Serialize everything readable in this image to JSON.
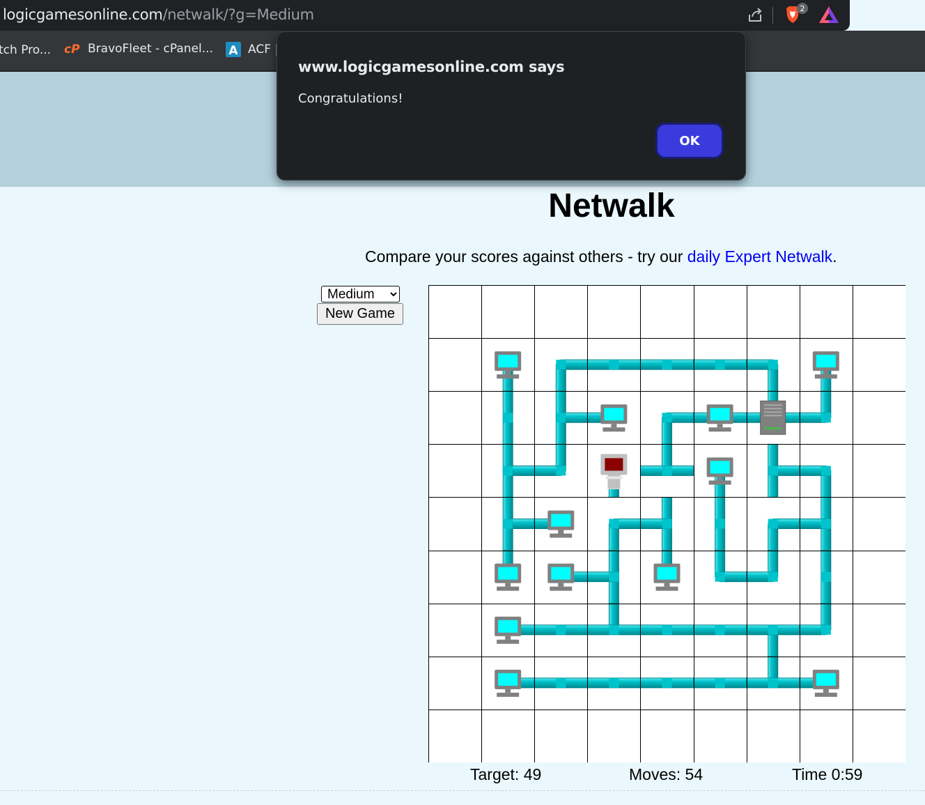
{
  "browser": {
    "url_host": "logicgamesonline.com",
    "url_path": "/netwalk/?g=Medium",
    "brave_badge": "2",
    "bookmarks": [
      {
        "label": "tch Pro...",
        "icon": "none"
      },
      {
        "label": "BravoFleet - cPanel...",
        "icon": "cpanel-icon"
      },
      {
        "label": "ACF |",
        "icon": "acf-icon"
      }
    ]
  },
  "dialog": {
    "title": "www.logicgamesonline.com says",
    "message": "Congratulations!",
    "ok_label": "OK"
  },
  "page": {
    "title": "Netwalk",
    "promo_prefix": "Compare your scores against others - try our ",
    "promo_link": "daily Expert Netwalk",
    "promo_suffix": ".",
    "difficulty_selected": "Medium",
    "new_game_label": "New Game"
  },
  "status": {
    "target": "Target: 49",
    "moves": "Moves: 54",
    "time": "Time 0:59"
  },
  "colors": {
    "pipe": "#00c4cc",
    "grid_line": "#000000",
    "monitor_screen": "#00ffff",
    "server_light": "#8b0000",
    "dialog_button": "#3b3bdd"
  },
  "board": {
    "rows": 9,
    "cols": 9,
    "server": {
      "row": 2,
      "col": 6
    },
    "dead_terminal": {
      "row": 3,
      "col": 3
    },
    "terminals": [
      [
        1,
        1
      ],
      [
        1,
        7
      ],
      [
        2,
        3
      ],
      [
        2,
        5
      ],
      [
        3,
        5
      ],
      [
        4,
        2
      ],
      [
        5,
        1
      ],
      [
        5,
        2
      ],
      [
        5,
        4
      ],
      [
        6,
        1
      ],
      [
        7,
        1
      ],
      [
        7,
        7
      ]
    ],
    "cells": [
      [
        "",
        "",
        "",
        "",
        "",
        "",
        "",
        "",
        ""
      ],
      [
        "",
        "S",
        "SE",
        "EW",
        "EW",
        "EW",
        "SW",
        "S",
        ""
      ],
      [
        "",
        "NS",
        "NES",
        "W",
        "SE",
        "EW",
        "NEW",
        "NW",
        ""
      ],
      [
        "",
        "NES",
        "NW",
        "S",
        "NEW",
        "S",
        "NSE",
        "SW",
        ""
      ],
      [
        "",
        "NES",
        "W",
        "SE",
        "NSW",
        "NS",
        "SE",
        "NSW",
        ""
      ],
      [
        "",
        "N",
        "E",
        "NSW",
        "N",
        "NE",
        "NW",
        "NS",
        ""
      ],
      [
        "",
        "E",
        "EW",
        "NEW",
        "EW",
        "EW",
        "ESW",
        "NW",
        ""
      ],
      [
        "",
        "E",
        "EW",
        "EW",
        "EW",
        "EW",
        "NEW",
        "W",
        ""
      ],
      [
        "",
        "",
        "",
        "",
        "",
        "",
        "",
        "",
        ""
      ]
    ]
  }
}
